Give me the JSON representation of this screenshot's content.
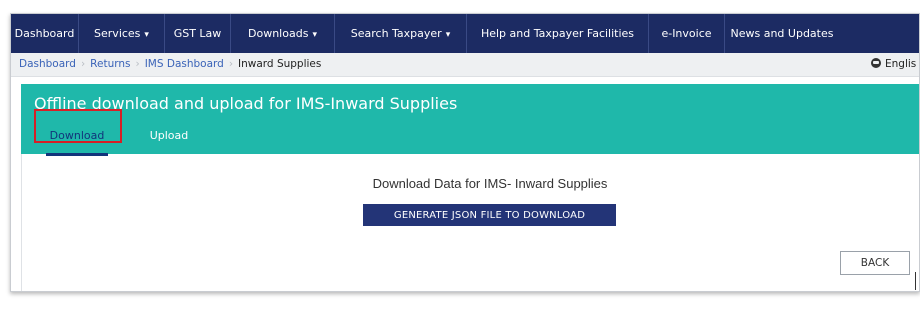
{
  "nav": {
    "items": [
      {
        "label": "Dashboard",
        "has_dropdown": false
      },
      {
        "label": "Services",
        "has_dropdown": true
      },
      {
        "label": "GST Law",
        "has_dropdown": false
      },
      {
        "label": "Downloads",
        "has_dropdown": true
      },
      {
        "label": "Search Taxpayer",
        "has_dropdown": true
      },
      {
        "label": "Help and Taxpayer Facilities",
        "has_dropdown": false
      },
      {
        "label": "e-Invoice",
        "has_dropdown": false
      },
      {
        "label": "News and Updates",
        "has_dropdown": false
      }
    ],
    "caret": "▾"
  },
  "breadcrumb": {
    "items": [
      "Dashboard",
      "Returns",
      "IMS Dashboard"
    ],
    "current": "Inward Supplies",
    "separator": "›"
  },
  "language": {
    "label": "Englis",
    "icon": "globe-icon"
  },
  "panel": {
    "title": "Offline download and upload for IMS-Inward Supplies",
    "tabs": [
      {
        "label": "Download",
        "active": true
      },
      {
        "label": "Upload",
        "active": false
      }
    ]
  },
  "content": {
    "heading": "Download Data for IMS- Inward Supplies",
    "generate_button": "GENERATE JSON FILE TO DOWNLOAD",
    "back_button": "BACK"
  },
  "colors": {
    "navbar": "#1c2b63",
    "breadcrumb_bg": "#eef0f2",
    "teal_header": "#1fb8aa",
    "primary_button": "#233477",
    "highlight": "#d81f26"
  }
}
